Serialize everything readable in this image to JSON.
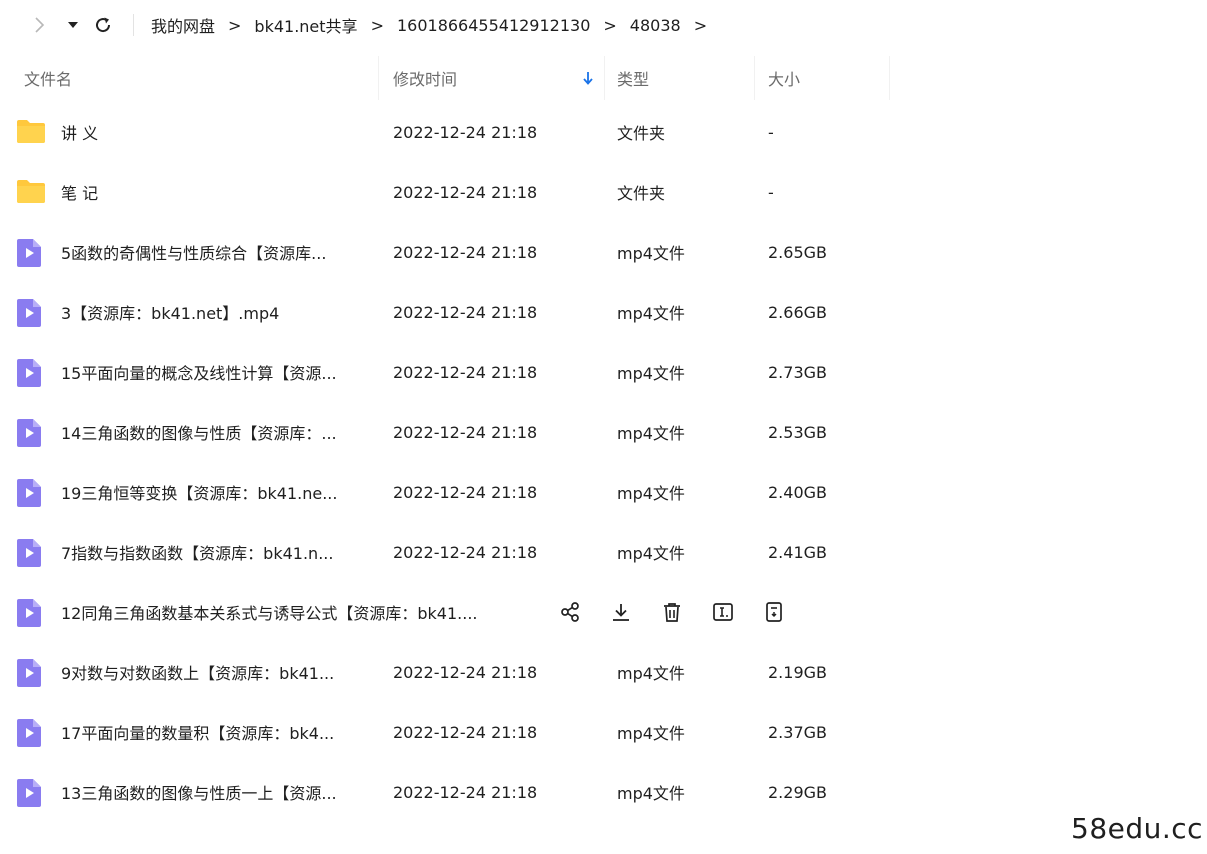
{
  "breadcrumb": [
    "我的网盘",
    "bk41.net共享",
    "1601866455412912130",
    "48038"
  ],
  "breadcrumb_separator": ">",
  "columns": {
    "name": "文件名",
    "modified": "修改时间",
    "type": "类型",
    "size": "大小"
  },
  "rows": [
    {
      "kind": "folder",
      "name": "讲 义",
      "date": "2022-12-24 21:18",
      "type": "文件夹",
      "size": "-"
    },
    {
      "kind": "folder",
      "name": "笔 记",
      "date": "2022-12-24 21:18",
      "type": "文件夹",
      "size": "-"
    },
    {
      "kind": "video",
      "name": "5函数的奇偶性与性质综合【资源库...",
      "date": "2022-12-24 21:18",
      "type": "mp4文件",
      "size": "2.65GB"
    },
    {
      "kind": "video",
      "name": "3【资源库：bk41.net】.mp4",
      "date": "2022-12-24 21:18",
      "type": "mp4文件",
      "size": "2.66GB"
    },
    {
      "kind": "video",
      "name": "15平面向量的概念及线性计算【资源...",
      "date": "2022-12-24 21:18",
      "type": "mp4文件",
      "size": "2.73GB"
    },
    {
      "kind": "video",
      "name": "14三角函数的图像与性质【资源库：...",
      "date": "2022-12-24 21:18",
      "type": "mp4文件",
      "size": "2.53GB"
    },
    {
      "kind": "video",
      "name": "19三角恒等变换【资源库：bk41.ne...",
      "date": "2022-12-24 21:18",
      "type": "mp4文件",
      "size": "2.40GB"
    },
    {
      "kind": "video",
      "name": "7指数与指数函数【资源库：bk41.n...",
      "date": "2022-12-24 21:18",
      "type": "mp4文件",
      "size": "2.41GB"
    },
    {
      "kind": "video",
      "name": "12同角三角函数基本关系式与诱导公式【资源库：bk41....",
      "hovered": true
    },
    {
      "kind": "video",
      "name": "9对数与对数函数上【资源库：bk41...",
      "date": "2022-12-24 21:18",
      "type": "mp4文件",
      "size": "2.19GB"
    },
    {
      "kind": "video",
      "name": "17平面向量的数量积【资源库：bk4...",
      "date": "2022-12-24 21:18",
      "type": "mp4文件",
      "size": "2.37GB"
    },
    {
      "kind": "video",
      "name": "13三角函数的图像与性质一上【资源...",
      "date": "2022-12-24 21:18",
      "type": "mp4文件",
      "size": "2.29GB"
    }
  ],
  "hover_actions": [
    "share-icon",
    "download-icon",
    "delete-icon",
    "rename-icon",
    "more-icon"
  ],
  "watermark": "58edu.cc",
  "colors": {
    "folder": "#FFC83D",
    "video": "#8A7CF0",
    "sort_arrow": "#1a73e8"
  }
}
